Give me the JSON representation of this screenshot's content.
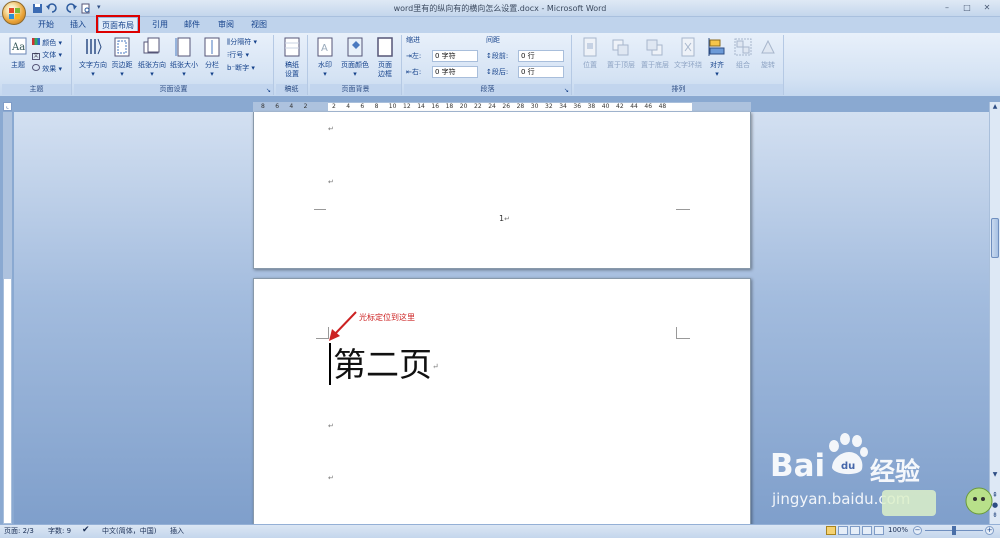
{
  "window": {
    "title": "word里有的纵向有的横向怎么设置.docx - Microsoft Word",
    "min": "–",
    "max": "□",
    "close": "✕"
  },
  "tabs": [
    "开始",
    "插入",
    "页面布局",
    "引用",
    "邮件",
    "审阅",
    "视图"
  ],
  "active_tab": "页面布局",
  "ribbon": {
    "theme": {
      "big": "主题",
      "colors": "颜色",
      "fonts": "文体",
      "effects": "效果",
      "label": "主题"
    },
    "page_setup": {
      "text_direction": "文字方向",
      "margins": "页边距",
      "orientation": "纸张方向",
      "size": "纸张大小",
      "columns": "分栏",
      "breaks": "分隔符",
      "line_numbers": "行号",
      "hyphenation": "断字",
      "label": "页面设置"
    },
    "manuscript": {
      "big1": "稿纸",
      "big2": "设置",
      "label": "稿纸"
    },
    "page_background": {
      "watermark": "水印",
      "page_color": "页面颜色",
      "borders1": "页面",
      "borders2": "边框",
      "label": "页面背景"
    },
    "paragraph": {
      "indent_title": "缩进",
      "spacing_title": "间距",
      "left_label": "左:",
      "left_value": "0 字符",
      "right_label": "右:",
      "right_value": "0 字符",
      "before_label": "段前:",
      "before_value": "0 行",
      "after_label": "段后:",
      "after_value": "0 行",
      "label": "段落"
    },
    "arrange": {
      "position": "位置",
      "front": "置于顶层",
      "back": "置于底层",
      "wrap": "文字环绕",
      "align": "对齐",
      "group": "组合",
      "rotate": "旋转",
      "label": "排列"
    }
  },
  "ruler_numbers": [
    "8",
    "6",
    "4",
    "2",
    "",
    "2",
    "4",
    "6",
    "8",
    "10",
    "12",
    "14",
    "16",
    "18",
    "20",
    "22",
    "24",
    "26",
    "28",
    "30",
    "32",
    "34",
    "36",
    "38",
    "40",
    "42",
    "44",
    "46",
    "48"
  ],
  "document": {
    "page_number": "1",
    "annotation": "光标定位到这里",
    "heading": "第二页",
    "para_mark": "↵"
  },
  "statusbar": {
    "page": "页面: 2/3",
    "words": "字数: 9",
    "language": "中文(简体，中国)",
    "mode": "插入",
    "zoom": "100%"
  },
  "watermark": {
    "brand": "Bai",
    "brand2": "经验",
    "url": "jingyan.baidu.com"
  },
  "colors": {
    "accent": "#15428b",
    "highlight": "#dd0000",
    "annotation": "#cc2222"
  }
}
